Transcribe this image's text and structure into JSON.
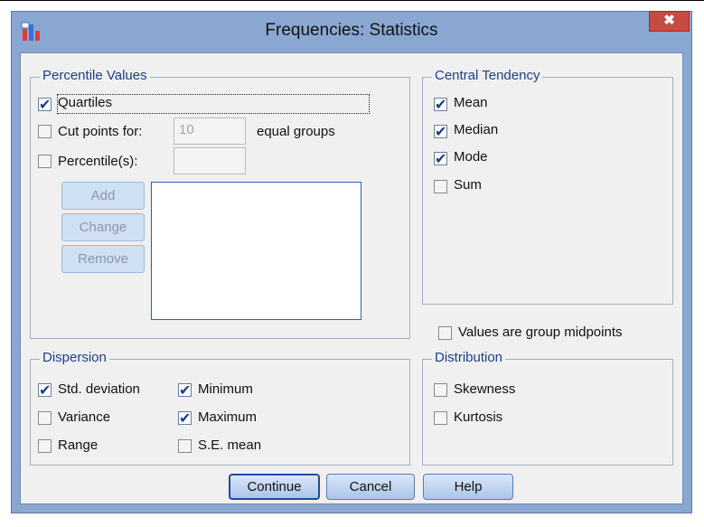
{
  "window": {
    "title": "Frequencies: Statistics",
    "close_symbol": "✖"
  },
  "percentile_values": {
    "legend": "Percentile Values",
    "quartiles": {
      "label": "Quartiles",
      "checked": true
    },
    "cut_points": {
      "label": "Cut points for:",
      "checked": false,
      "value": "10",
      "suffix": "equal groups"
    },
    "percentiles": {
      "label": "Percentile(s):",
      "checked": false,
      "value": ""
    },
    "add_label": "Add",
    "change_label": "Change",
    "remove_label": "Remove"
  },
  "central_tendency": {
    "legend": "Central Tendency",
    "items": [
      {
        "label": "Mean",
        "checked": true
      },
      {
        "label": "Median",
        "checked": true
      },
      {
        "label": "Mode",
        "checked": true
      },
      {
        "label": "Sum",
        "checked": false
      }
    ]
  },
  "group_midpoints": {
    "label": "Values are group midpoints",
    "checked": false
  },
  "dispersion": {
    "legend": "Dispersion",
    "items": [
      {
        "label": "Std. deviation",
        "checked": true
      },
      {
        "label": "Minimum",
        "checked": true
      },
      {
        "label": "Variance",
        "checked": false
      },
      {
        "label": "Maximum",
        "checked": true
      },
      {
        "label": "Range",
        "checked": false
      },
      {
        "label": "S.E. mean",
        "checked": false
      }
    ]
  },
  "distribution": {
    "legend": "Distribution",
    "items": [
      {
        "label": "Skewness",
        "checked": false
      },
      {
        "label": "Kurtosis",
        "checked": false
      }
    ]
  },
  "buttons": {
    "continue": "Continue",
    "cancel": "Cancel",
    "help": "Help"
  },
  "colors": {
    "frame": "#8aa7d2",
    "close": "#c74b42",
    "legend_text": "#1c3f8c",
    "checkmark": "#1a3d8f"
  }
}
